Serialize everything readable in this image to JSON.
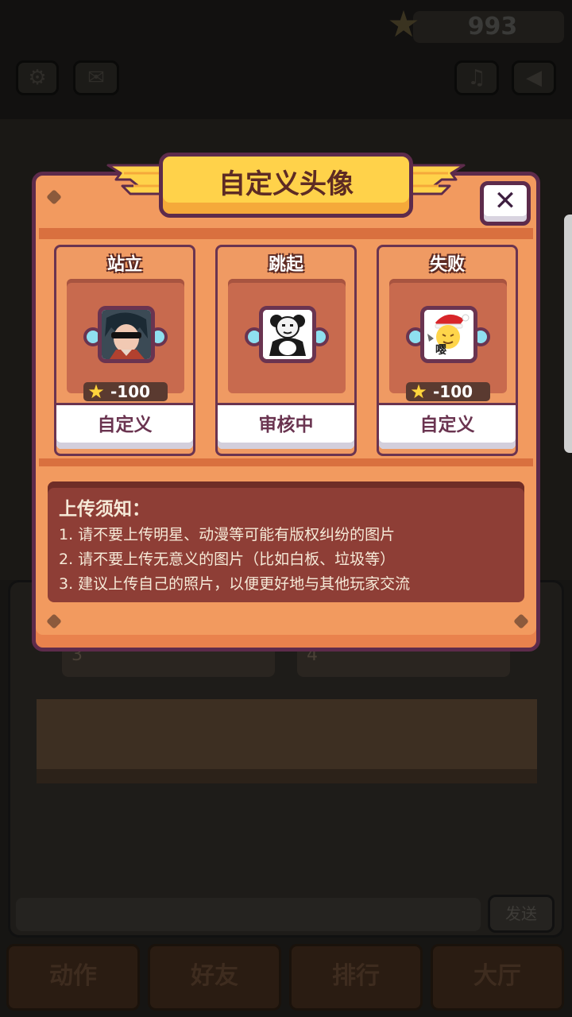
{
  "hud": {
    "coins": "993",
    "icons": [
      "settings-icon",
      "mail-icon",
      "music-icon",
      "sound-icon"
    ]
  },
  "dialog": {
    "title": "自定义头像",
    "close_label": "✕",
    "cards": [
      {
        "title": "站立",
        "cost": "-100",
        "button": "自定义",
        "avatar": "anime-character-avatar"
      },
      {
        "title": "跳起",
        "cost": "",
        "button": "审核中",
        "avatar": "panda-meme-avatar"
      },
      {
        "title": "失败",
        "cost": "-100",
        "button": "自定义",
        "avatar": "christmas-emoji-avatar",
        "avatar_text": "嘤"
      }
    ],
    "notice": {
      "title": "上传须知：",
      "lines": [
        "1. 请不要上传明星、动漫等可能有版权纠纷的图片",
        "2. 请不要上传无意义的图片（比如白板、垃圾等）",
        "3. 建议上传自己的照片，以便更好地与其他玩家交流"
      ]
    }
  },
  "background": {
    "slot_left": "3",
    "slot_right": "4",
    "send_label": "发送",
    "tabs": [
      "动作",
      "好友",
      "排行",
      "大厅"
    ]
  },
  "colors": {
    "dialog_body": "#f29a5f",
    "dialog_border": "#5d2b4b",
    "banner": "#ffd24a",
    "notice_bg": "#8e3e36",
    "knob": "#8fe0f0"
  }
}
